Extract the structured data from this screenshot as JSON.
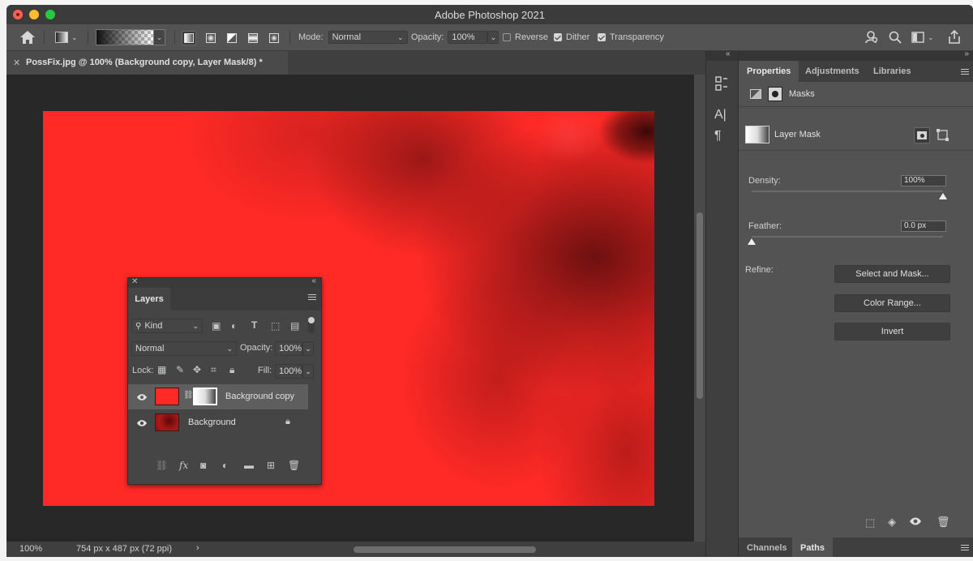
{
  "window": {
    "title": "Adobe Photoshop 2021"
  },
  "options_bar": {
    "mode_label": "Mode:",
    "mode_value": "Normal",
    "opacity_label": "Opacity:",
    "opacity_value": "100%",
    "reverse_label": "Reverse",
    "reverse_checked": false,
    "dither_label": "Dither",
    "dither_checked": true,
    "transparency_label": "Transparency",
    "transparency_checked": true
  },
  "document": {
    "tab_title": "PossFix.jpg @ 100% (Background copy, Layer Mask/8) *"
  },
  "status": {
    "zoom": "100%",
    "dimensions": "754 px x 487 px (72 ppi)",
    "arrow": "›"
  },
  "layers_panel": {
    "tab": "Layers",
    "filter_kind": "Kind",
    "blend_mode": "Normal",
    "opacity_label": "Opacity:",
    "opacity_value": "100%",
    "lock_label": "Lock:",
    "fill_label": "Fill:",
    "fill_value": "100%",
    "layers": [
      {
        "name": "Background copy",
        "selected": true
      },
      {
        "name": "Background",
        "selected": false
      }
    ],
    "bottom_fx": "fx"
  },
  "properties_panel": {
    "tabs": [
      "Properties",
      "Adjustments",
      "Libraries"
    ],
    "masks_label": "Masks",
    "layer_mask_label": "Layer Mask",
    "density_label": "Density:",
    "density_value": "100%",
    "density_level": 1.0,
    "feather_label": "Feather:",
    "feather_value": "0.0 px",
    "feather_level": 0.0,
    "refine_label": "Refine:",
    "buttons": [
      "Select and Mask...",
      "Color Range...",
      "Invert"
    ],
    "bottom_tabs": [
      "Channels",
      "Paths"
    ]
  },
  "dock": {
    "char_icon": "A|",
    "para_icon": "¶"
  },
  "colors": {
    "canvas_red": "#ff2a26",
    "panel_bg": "#535353",
    "dark_bg": "#282828"
  }
}
